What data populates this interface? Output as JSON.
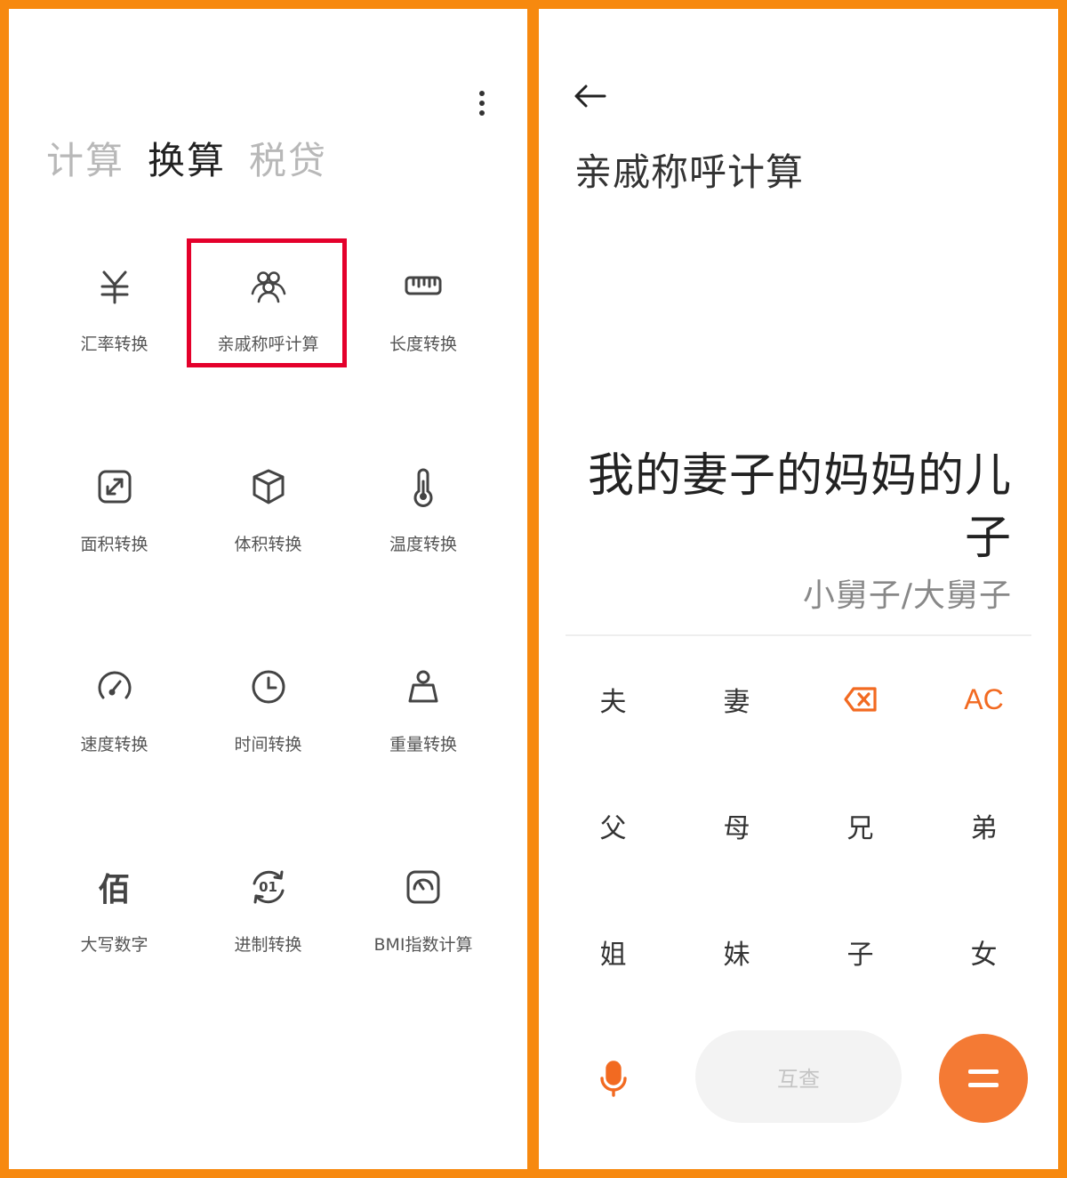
{
  "left": {
    "tabs": [
      {
        "label": "计算",
        "active": false
      },
      {
        "label": "换算",
        "active": true
      },
      {
        "label": "税贷",
        "active": false
      }
    ],
    "tools": [
      {
        "label": "汇率转换",
        "icon": "currency-icon"
      },
      {
        "label": "亲戚称呼计算",
        "icon": "relatives-icon"
      },
      {
        "label": "长度转换",
        "icon": "ruler-icon"
      },
      {
        "label": "面积转换",
        "icon": "area-icon"
      },
      {
        "label": "体积转换",
        "icon": "cube-icon"
      },
      {
        "label": "温度转换",
        "icon": "thermometer-icon"
      },
      {
        "label": "速度转换",
        "icon": "speedometer-icon"
      },
      {
        "label": "时间转换",
        "icon": "clock-icon"
      },
      {
        "label": "重量转换",
        "icon": "weight-icon"
      },
      {
        "label": "大写数字",
        "icon": "capital-number-icon",
        "glyph": "佰"
      },
      {
        "label": "进制转换",
        "icon": "base-conversion-icon",
        "glyph": "01"
      },
      {
        "label": "BMI指数计算",
        "icon": "bmi-scale-icon"
      }
    ],
    "highlight_color": "#E4002B"
  },
  "right": {
    "title": "亲戚称呼计算",
    "expression": "我的妻子的妈妈的儿子",
    "result": "小舅子/大舅子",
    "keys": [
      {
        "label": "夫"
      },
      {
        "label": "妻"
      },
      {
        "label": "",
        "icon": "backspace-icon"
      },
      {
        "label": "AC"
      },
      {
        "label": "父"
      },
      {
        "label": "母"
      },
      {
        "label": "兄"
      },
      {
        "label": "弟"
      },
      {
        "label": "姐"
      },
      {
        "label": "妹"
      },
      {
        "label": "子"
      },
      {
        "label": "女"
      }
    ],
    "mutual_label": "互查",
    "accent_color": "#F26A21"
  },
  "frame_color": "#F7890F"
}
